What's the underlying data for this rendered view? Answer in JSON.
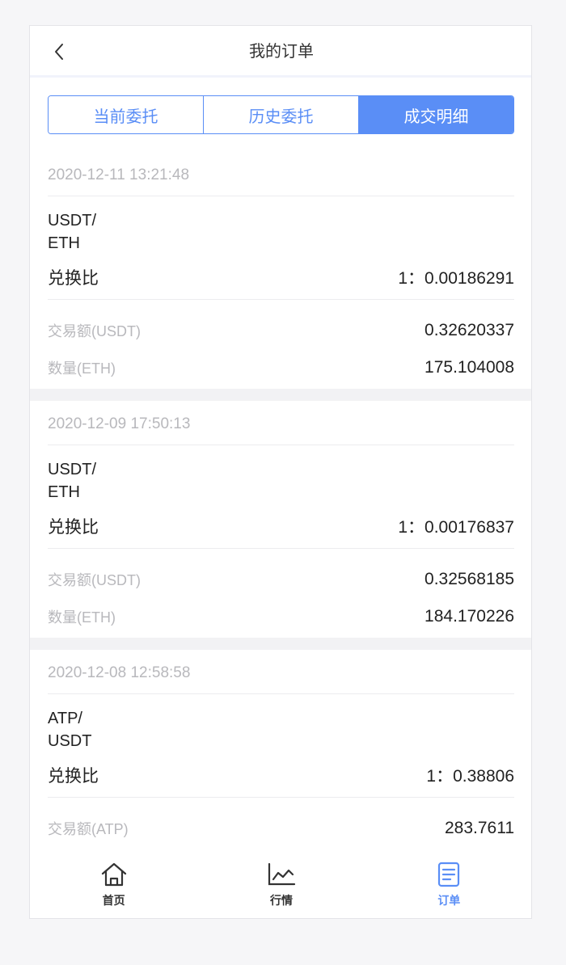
{
  "header": {
    "title": "我的订单"
  },
  "tabs": [
    {
      "label": "当前委托"
    },
    {
      "label": "历史委托"
    },
    {
      "label": "成交明细"
    }
  ],
  "orders": [
    {
      "date": "2020-12-11 13:21:48",
      "pair_base": "USDT/",
      "pair_quote": "ETH",
      "rate_label": "兑换比",
      "rate_value": "1：0.00186291",
      "amount_label": "交易额(USDT)",
      "amount_value": "0.32620337",
      "qty_label": "数量(ETH)",
      "qty_value": "175.104008"
    },
    {
      "date": "2020-12-09 17:50:13",
      "pair_base": "USDT/",
      "pair_quote": "ETH",
      "rate_label": "兑换比",
      "rate_value": "1：0.00176837",
      "amount_label": "交易额(USDT)",
      "amount_value": "0.32568185",
      "qty_label": "数量(ETH)",
      "qty_value": "184.170226"
    },
    {
      "date": "2020-12-08 12:58:58",
      "pair_base": "ATP/",
      "pair_quote": "USDT",
      "rate_label": "兑换比",
      "rate_value": "1：0.38806",
      "amount_label": "交易额(ATP)",
      "amount_value": "283.7611"
    }
  ],
  "tabbar": [
    {
      "label": "首页",
      "icon": "home-icon"
    },
    {
      "label": "行情",
      "icon": "chart-line-icon"
    },
    {
      "label": "订单",
      "icon": "document-icon"
    }
  ],
  "colors": {
    "accent": "#5a8ef6",
    "muted": "#b8b8bc",
    "text": "#222222"
  }
}
